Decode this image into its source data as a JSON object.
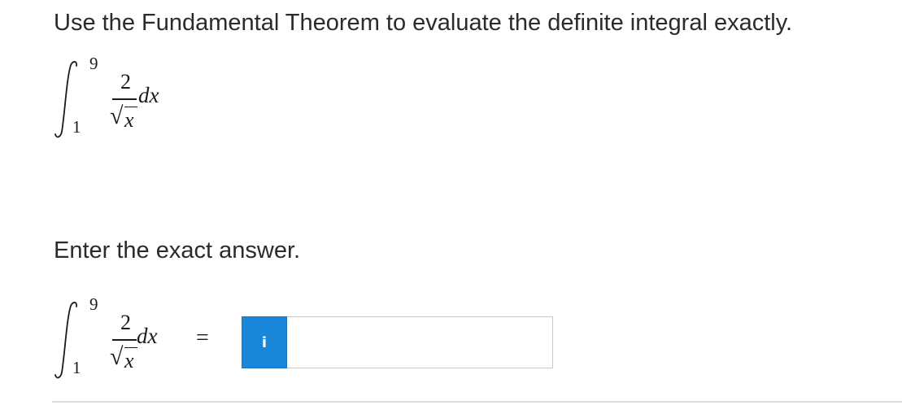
{
  "question": {
    "text": "Use the Fundamental Theorem to evaluate the definite integral exactly."
  },
  "integral": {
    "upper_limit": "9",
    "lower_limit": "1",
    "numerator": "2",
    "radical": "√",
    "radicand": "x",
    "differential": "dx"
  },
  "prompt": {
    "text": "Enter the exact answer."
  },
  "answer": {
    "equals": "=",
    "info_label": "i",
    "value": "",
    "placeholder": ""
  }
}
